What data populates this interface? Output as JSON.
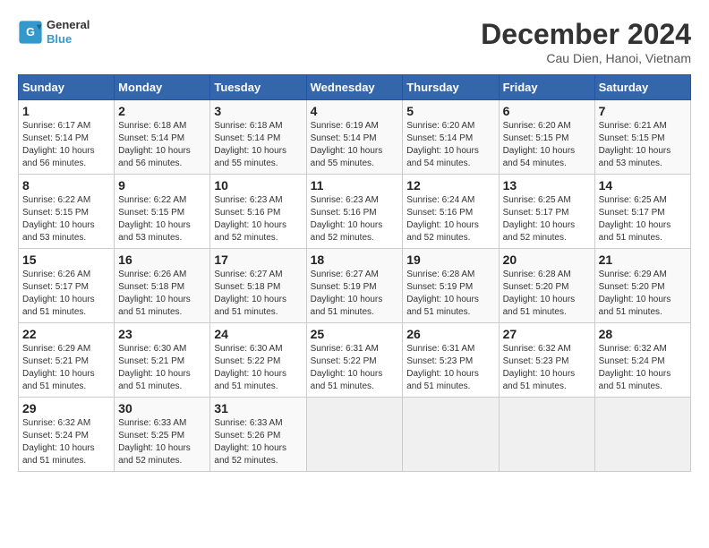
{
  "header": {
    "logo_line1": "General",
    "logo_line2": "Blue",
    "month_title": "December 2024",
    "location": "Cau Dien, Hanoi, Vietnam"
  },
  "weekdays": [
    "Sunday",
    "Monday",
    "Tuesday",
    "Wednesday",
    "Thursday",
    "Friday",
    "Saturday"
  ],
  "weeks": [
    [
      {
        "day": "1",
        "sunrise": "6:17 AM",
        "sunset": "5:14 PM",
        "daylight": "10 hours and 56 minutes."
      },
      {
        "day": "2",
        "sunrise": "6:18 AM",
        "sunset": "5:14 PM",
        "daylight": "10 hours and 56 minutes."
      },
      {
        "day": "3",
        "sunrise": "6:18 AM",
        "sunset": "5:14 PM",
        "daylight": "10 hours and 55 minutes."
      },
      {
        "day": "4",
        "sunrise": "6:19 AM",
        "sunset": "5:14 PM",
        "daylight": "10 hours and 55 minutes."
      },
      {
        "day": "5",
        "sunrise": "6:20 AM",
        "sunset": "5:14 PM",
        "daylight": "10 hours and 54 minutes."
      },
      {
        "day": "6",
        "sunrise": "6:20 AM",
        "sunset": "5:15 PM",
        "daylight": "10 hours and 54 minutes."
      },
      {
        "day": "7",
        "sunrise": "6:21 AM",
        "sunset": "5:15 PM",
        "daylight": "10 hours and 53 minutes."
      }
    ],
    [
      {
        "day": "8",
        "sunrise": "6:22 AM",
        "sunset": "5:15 PM",
        "daylight": "10 hours and 53 minutes."
      },
      {
        "day": "9",
        "sunrise": "6:22 AM",
        "sunset": "5:15 PM",
        "daylight": "10 hours and 53 minutes."
      },
      {
        "day": "10",
        "sunrise": "6:23 AM",
        "sunset": "5:16 PM",
        "daylight": "10 hours and 52 minutes."
      },
      {
        "day": "11",
        "sunrise": "6:23 AM",
        "sunset": "5:16 PM",
        "daylight": "10 hours and 52 minutes."
      },
      {
        "day": "12",
        "sunrise": "6:24 AM",
        "sunset": "5:16 PM",
        "daylight": "10 hours and 52 minutes."
      },
      {
        "day": "13",
        "sunrise": "6:25 AM",
        "sunset": "5:17 PM",
        "daylight": "10 hours and 52 minutes."
      },
      {
        "day": "14",
        "sunrise": "6:25 AM",
        "sunset": "5:17 PM",
        "daylight": "10 hours and 51 minutes."
      }
    ],
    [
      {
        "day": "15",
        "sunrise": "6:26 AM",
        "sunset": "5:17 PM",
        "daylight": "10 hours and 51 minutes."
      },
      {
        "day": "16",
        "sunrise": "6:26 AM",
        "sunset": "5:18 PM",
        "daylight": "10 hours and 51 minutes."
      },
      {
        "day": "17",
        "sunrise": "6:27 AM",
        "sunset": "5:18 PM",
        "daylight": "10 hours and 51 minutes."
      },
      {
        "day": "18",
        "sunrise": "6:27 AM",
        "sunset": "5:19 PM",
        "daylight": "10 hours and 51 minutes."
      },
      {
        "day": "19",
        "sunrise": "6:28 AM",
        "sunset": "5:19 PM",
        "daylight": "10 hours and 51 minutes."
      },
      {
        "day": "20",
        "sunrise": "6:28 AM",
        "sunset": "5:20 PM",
        "daylight": "10 hours and 51 minutes."
      },
      {
        "day": "21",
        "sunrise": "6:29 AM",
        "sunset": "5:20 PM",
        "daylight": "10 hours and 51 minutes."
      }
    ],
    [
      {
        "day": "22",
        "sunrise": "6:29 AM",
        "sunset": "5:21 PM",
        "daylight": "10 hours and 51 minutes."
      },
      {
        "day": "23",
        "sunrise": "6:30 AM",
        "sunset": "5:21 PM",
        "daylight": "10 hours and 51 minutes."
      },
      {
        "day": "24",
        "sunrise": "6:30 AM",
        "sunset": "5:22 PM",
        "daylight": "10 hours and 51 minutes."
      },
      {
        "day": "25",
        "sunrise": "6:31 AM",
        "sunset": "5:22 PM",
        "daylight": "10 hours and 51 minutes."
      },
      {
        "day": "26",
        "sunrise": "6:31 AM",
        "sunset": "5:23 PM",
        "daylight": "10 hours and 51 minutes."
      },
      {
        "day": "27",
        "sunrise": "6:32 AM",
        "sunset": "5:23 PM",
        "daylight": "10 hours and 51 minutes."
      },
      {
        "day": "28",
        "sunrise": "6:32 AM",
        "sunset": "5:24 PM",
        "daylight": "10 hours and 51 minutes."
      }
    ],
    [
      {
        "day": "29",
        "sunrise": "6:32 AM",
        "sunset": "5:24 PM",
        "daylight": "10 hours and 51 minutes."
      },
      {
        "day": "30",
        "sunrise": "6:33 AM",
        "sunset": "5:25 PM",
        "daylight": "10 hours and 52 minutes."
      },
      {
        "day": "31",
        "sunrise": "6:33 AM",
        "sunset": "5:26 PM",
        "daylight": "10 hours and 52 minutes."
      },
      null,
      null,
      null,
      null
    ]
  ]
}
